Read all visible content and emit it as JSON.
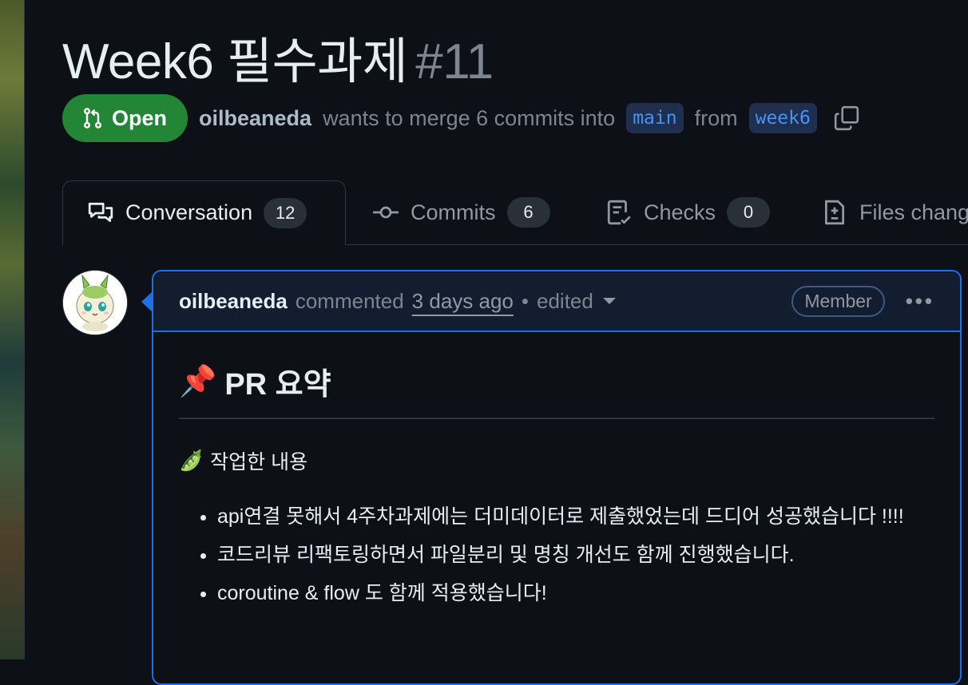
{
  "pr": {
    "title": "Week6 필수과제",
    "number": "#11",
    "state_label": "Open",
    "author": "oilbeaneda",
    "merge_text_a": "wants to merge 6 commits into",
    "base_branch": "main",
    "from_text": "from",
    "head_branch": "week6"
  },
  "tabs": [
    {
      "label": "Conversation",
      "count": "12",
      "icon": "comment-discussion-icon"
    },
    {
      "label": "Commits",
      "count": "6",
      "icon": "commit-icon"
    },
    {
      "label": "Checks",
      "count": "0",
      "icon": "checklist-icon"
    },
    {
      "label": "Files chang",
      "icon": "file-diff-icon"
    }
  ],
  "comment": {
    "author": "oilbeaneda",
    "action": "commented",
    "time": "3 days ago",
    "separator": "•",
    "edited": "edited",
    "badge": "Member",
    "more": "•••",
    "heading": "PR 요약",
    "heading_emoji": "📌",
    "section_emoji": "🫛",
    "section_label": "작업한 내용",
    "items": [
      "api연결 못해서 4주차과제에는 더미데이터로 제출했었는데 드디어 성공했습니다 !!!!",
      "코드리뷰 리팩토링하면서 파일분리 및 명칭 개선도 함께 진행했습니다.",
      "coroutine & flow 도 함께 적용했습니다!"
    ]
  },
  "colors": {
    "background": "#0d1117",
    "open_green": "#238636",
    "accent_blue": "#1f6feb",
    "link_blue": "#4493f8"
  }
}
